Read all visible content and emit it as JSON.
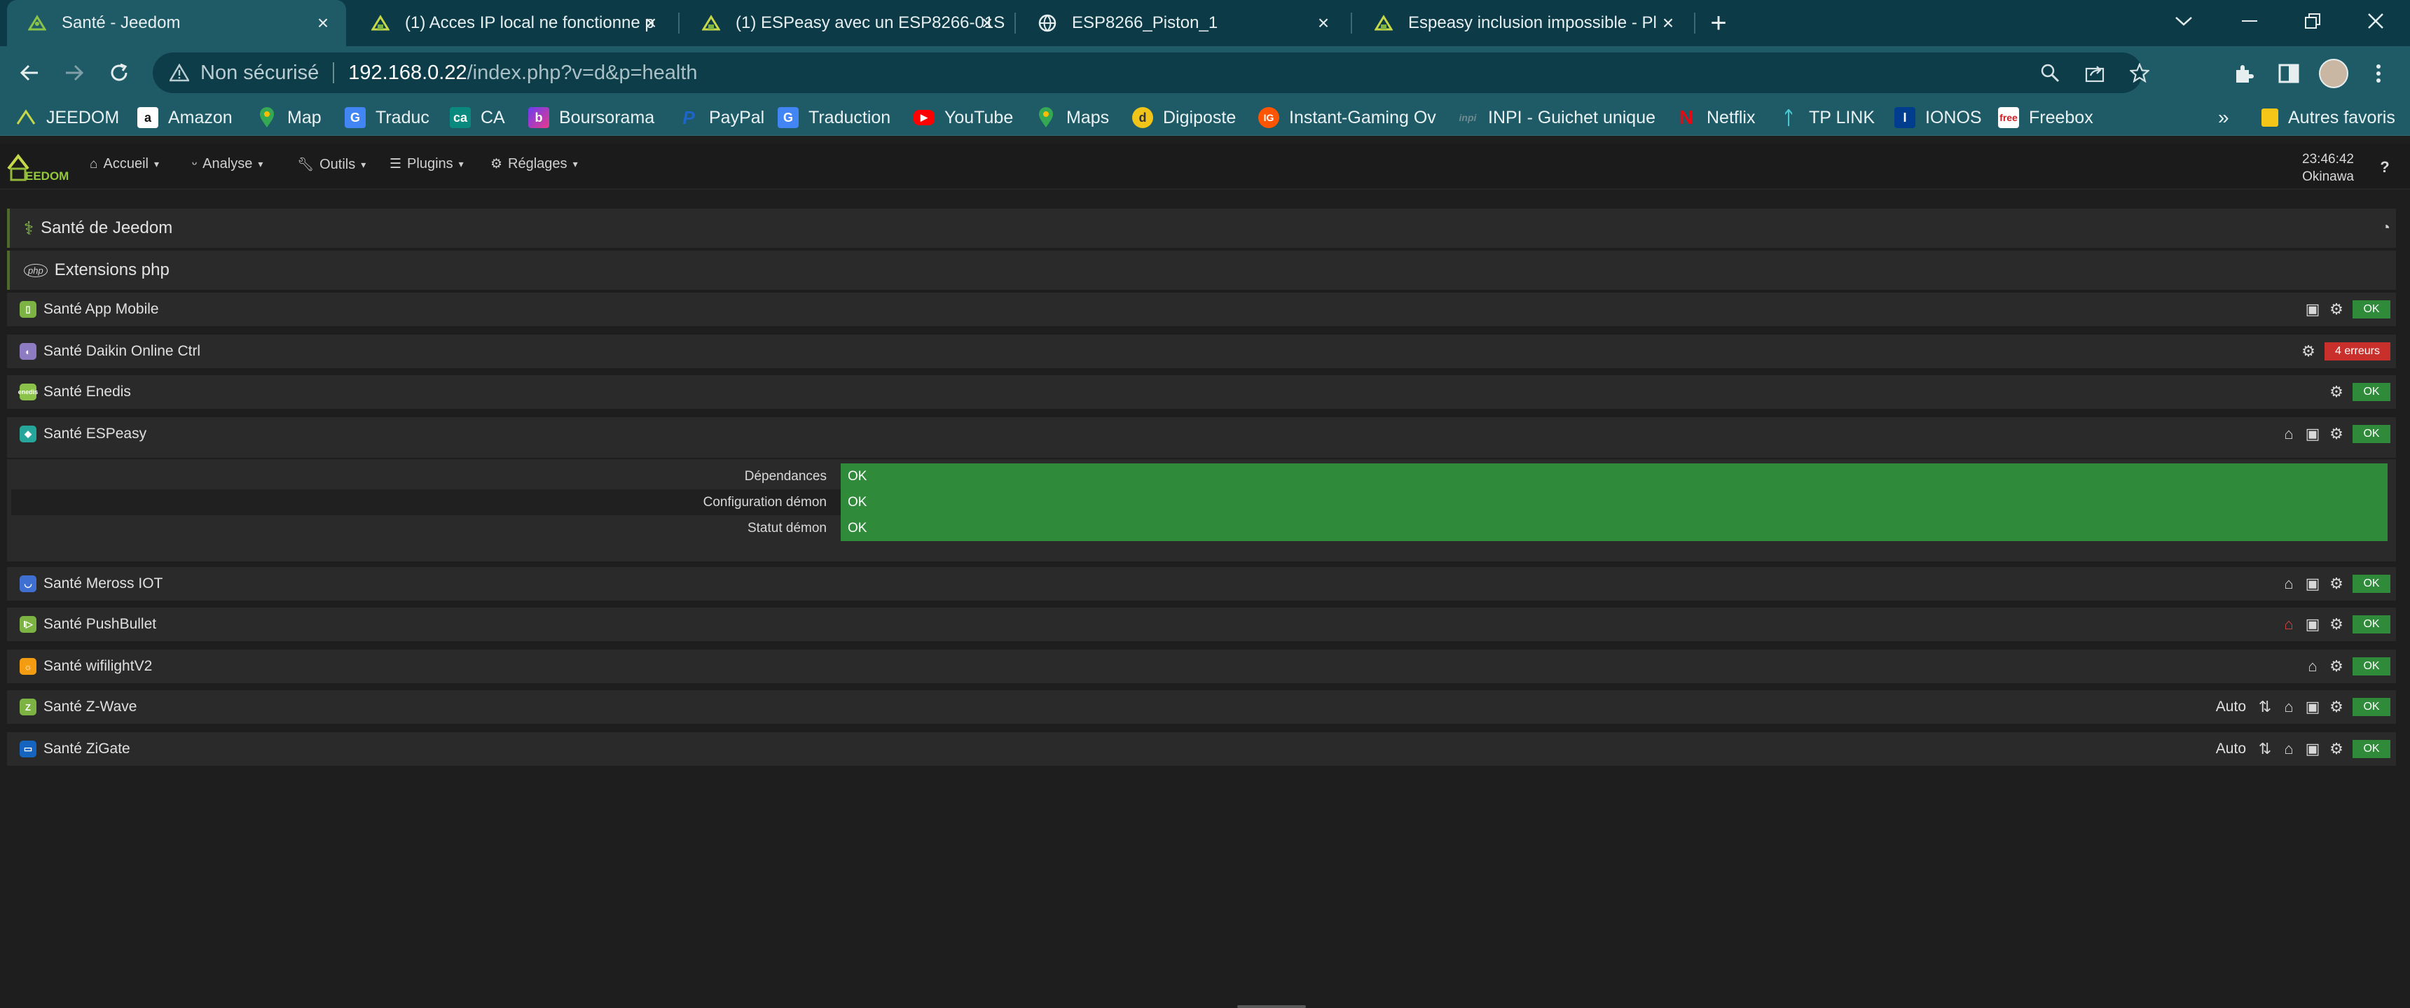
{
  "browser": {
    "tabs": [
      {
        "title": "Santé - Jeedom",
        "active": true,
        "favicon": "jeedom-icon"
      },
      {
        "title": "(1) Acces IP local ne fonctionne p",
        "active": false,
        "favicon": "jeedom-community-icon"
      },
      {
        "title": "(1) ESPeasy avec un ESP8266-01S",
        "active": false,
        "favicon": "jeedom-community-icon"
      },
      {
        "title": "ESP8266_Piston_1",
        "active": false,
        "favicon": "globe-icon"
      },
      {
        "title": "Espeasy inclusion impossible - Pl",
        "active": false,
        "favicon": "jeedom-community-icon"
      }
    ],
    "omnibox": {
      "security_label": "Non sécurisé",
      "url_host": "192.168.0.22",
      "url_path": "/index.php?v=d&p=health"
    },
    "bookmarks": [
      {
        "label": "JEEDOM",
        "icon": "jeedom-icon",
        "color": "#7cb342"
      },
      {
        "label": "Amazon",
        "icon": "amazon-icon",
        "color": "#ffffff"
      },
      {
        "label": "Map",
        "icon": "maps-pin-icon",
        "color": "#34a853"
      },
      {
        "label": "Traduc",
        "icon": "translate-icon",
        "color": "#4285f4"
      },
      {
        "label": "CA",
        "icon": "ca-icon",
        "color": "#0a8a7e"
      },
      {
        "label": "Boursorama",
        "icon": "boursorama-icon",
        "color": "#d6328c"
      },
      {
        "label": "PayPal",
        "icon": "paypal-icon",
        "color": "#1f64c8"
      },
      {
        "label": "Traduction",
        "icon": "translate-icon",
        "color": "#4285f4"
      },
      {
        "label": "YouTube",
        "icon": "youtube-icon",
        "color": "#ff0000"
      },
      {
        "label": "Maps",
        "icon": "maps-pin-icon",
        "color": "#34a853"
      },
      {
        "label": "Digiposte",
        "icon": "digiposte-icon",
        "color": "#f0c419"
      },
      {
        "label": "Instant-Gaming Ov",
        "icon": "instant-gaming-icon",
        "color": "#ff5400"
      },
      {
        "label": "INPI - Guichet unique",
        "icon": "inpi-icon",
        "color": "#2b2b2b"
      },
      {
        "label": "Netflix",
        "icon": "netflix-icon",
        "color": "#e50914"
      },
      {
        "label": "TP LINK",
        "icon": "tplink-icon",
        "color": "#4acbd6"
      },
      {
        "label": "IONOS",
        "icon": "ionos-icon",
        "color": "#003d8f"
      },
      {
        "label": "Freebox",
        "icon": "freebox-icon",
        "color": "#cd1e25"
      }
    ],
    "bookmarks_overflow": "»",
    "other_bookmarks": "Autres favoris"
  },
  "jeedom": {
    "menu": [
      {
        "label": "Accueil",
        "icon": "home-icon"
      },
      {
        "label": "Analyse",
        "icon": "stethoscope-icon"
      },
      {
        "label": "Outils",
        "icon": "wrench-icon"
      },
      {
        "label": "Plugins",
        "icon": "list-icon"
      },
      {
        "label": "Réglages",
        "icon": "cogs-icon"
      }
    ],
    "clock": {
      "time": "23:46:42",
      "zone": "Okinawa"
    },
    "help": "?"
  },
  "health": {
    "main_title": "Santé de Jeedom",
    "php_title": "Extensions php",
    "plugins": [
      {
        "name": "Santé App Mobile",
        "color": "#7cb342",
        "status": "OK",
        "status_type": "ok"
      },
      {
        "name": "Santé Daikin Online Ctrl",
        "color": "#8e7cc3",
        "status": "4 erreurs",
        "status_type": "error"
      },
      {
        "name": "Santé Enedis",
        "color": "#8bc34a",
        "status": "OK",
        "status_type": "ok"
      },
      {
        "name": "Santé ESPeasy",
        "color": "#26a69a",
        "status": "OK",
        "status_type": "ok"
      },
      {
        "name": "Santé Meross IOT",
        "color": "#3f6fd1",
        "status": "OK",
        "status_type": "ok"
      },
      {
        "name": "Santé PushBullet",
        "color": "#7cb342",
        "status": "OK",
        "status_type": "ok"
      },
      {
        "name": "Santé wifilightV2",
        "color": "#f39c12",
        "status": "OK",
        "status_type": "ok"
      },
      {
        "name": "Santé Z-Wave",
        "color": "#7cb342",
        "status": "OK",
        "status_type": "ok",
        "auto": "Auto"
      },
      {
        "name": "Santé ZiGate",
        "color": "#1565c0",
        "status": "OK",
        "status_type": "ok",
        "auto": "Auto"
      }
    ],
    "espeasy_details": [
      {
        "label": "Dépendances",
        "value": "OK"
      },
      {
        "label": "Configuration démon",
        "value": "OK"
      },
      {
        "label": "Statut démon",
        "value": "OK"
      }
    ]
  }
}
